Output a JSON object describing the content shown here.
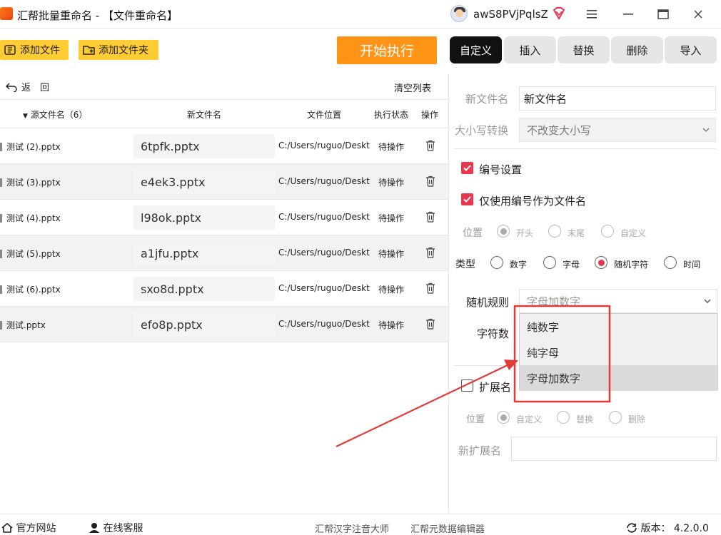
{
  "app": {
    "title": "汇帮批量重命名 - 【文件重命名】",
    "username": "awS8PVjPqlsZ"
  },
  "toolbar": {
    "add_files": "添加文件",
    "add_folder": "添加文件夹",
    "start": "开始执行"
  },
  "tabs": [
    "自定义",
    "插入",
    "替换",
    "删除",
    "导入"
  ],
  "list": {
    "back": "返　回",
    "clear": "清空列表",
    "headers": {
      "source": "源文件名（6）",
      "new_name": "新文件名",
      "location": "文件位置",
      "status": "执行状态",
      "action": "操作"
    },
    "rows": [
      {
        "source": "测试 (2).pptx",
        "new_name": "6tpfk.pptx",
        "location": "C:/Users/ruguo/Deskt",
        "status": "待操作"
      },
      {
        "source": "测试 (3).pptx",
        "new_name": "e4ek3.pptx",
        "location": "C:/Users/ruguo/Deskt",
        "status": "待操作"
      },
      {
        "source": "测试 (4).pptx",
        "new_name": "l98ok.pptx",
        "location": "C:/Users/ruguo/Deskt",
        "status": "待操作"
      },
      {
        "source": "测试 (5).pptx",
        "new_name": "a1jfu.pptx",
        "location": "C:/Users/ruguo/Deskt",
        "status": "待操作"
      },
      {
        "source": "测试 (6).pptx",
        "new_name": "sxo8d.pptx",
        "location": "C:/Users/ruguo/Deskt",
        "status": "待操作"
      },
      {
        "source": "测试.pptx",
        "new_name": "efo8p.pptx",
        "location": "C:/Users/ruguo/Deskt",
        "status": "待操作"
      }
    ]
  },
  "panel": {
    "new_name_label": "新文件名",
    "new_name_value": "新文件名",
    "case_label": "大小写转换",
    "case_value": "不改变大小写",
    "numbering_label": "编号设置",
    "numbering_checked": true,
    "only_number_label": "仅使用编号作为文件名",
    "only_number_checked": true,
    "position_label": "位置",
    "position_options": [
      "开头",
      "末尾",
      "自定义"
    ],
    "type_label": "类型",
    "type_options": [
      "数字",
      "字母",
      "随机字符",
      "时间"
    ],
    "type_selected": "随机字符",
    "random_rule_label": "随机规则",
    "random_rule_value": "字母加数字",
    "char_count_label": "字符数",
    "dropdown_options": [
      "纯数字",
      "纯字母",
      "字母加数字"
    ],
    "dropdown_selected": "字母加数字",
    "ext_label": "扩展名",
    "ext_checked": false,
    "ext_position_label": "位置",
    "ext_position_options": [
      "自定义",
      "替换",
      "删除"
    ],
    "new_ext_label": "新扩展名",
    "new_ext_value": ""
  },
  "footer": {
    "website": "官方网站",
    "support": "在线客服",
    "product1": "汇帮汉字注音大师",
    "product2": "汇帮元数据编辑器",
    "version": "版本：  4.2.0.0"
  },
  "colors": {
    "accent_orange": "#ff9416",
    "button_yellow": "#ffcc33",
    "check_red": "#e8364f",
    "annotation_red": "#e53935"
  }
}
